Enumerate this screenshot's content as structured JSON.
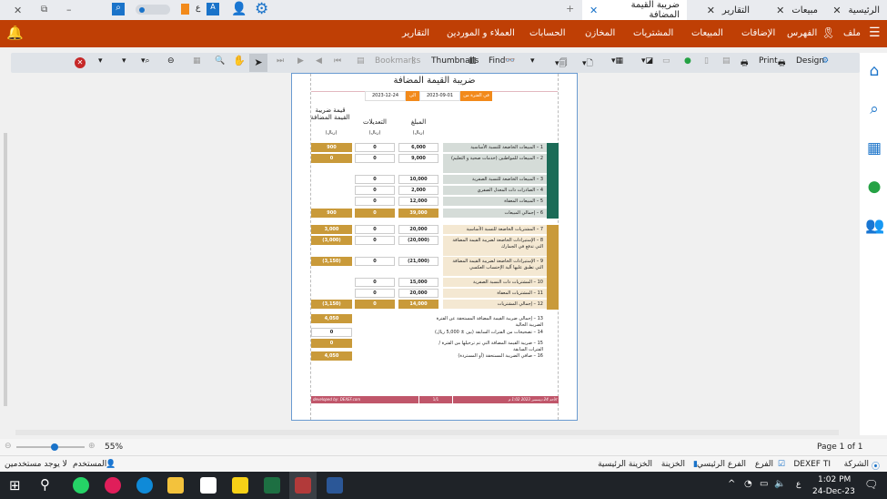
{
  "window": {
    "tabs": [
      {
        "label": "الرئيسية"
      },
      {
        "label": "مبيعات"
      },
      {
        "label": "التقارير"
      },
      {
        "label": "ضريبة القيمة المضافة",
        "active": true
      }
    ],
    "new_tab": "+",
    "lang_indicator": "ع"
  },
  "menu": {
    "items": [
      "ملف",
      "الفهرس",
      "الإضافات",
      "المبيعات",
      "المشتريات",
      "المخازن",
      "الحسابات",
      "العملاء و الموردين",
      "التقارير"
    ]
  },
  "toolbar": {
    "design": "Design",
    "print": "Print",
    "find": "Find",
    "thumbnails": "Thumbnails",
    "bookmarks": "Bookmarks"
  },
  "report": {
    "title": "ضريبة القيمة المضافة",
    "period_from_label": "في الفترة من",
    "date_from": "2023-09-01",
    "to_label": "الى",
    "date_to": "2023-12-24",
    "col_amount": "المبلغ",
    "col_adjust": "التعديلات",
    "col_vat": "قيمة ضريبة القيمة المضافة",
    "unit": "(ريال)",
    "sales_rows": [
      {
        "label": "1 – المبيعات الخاضعة للنسبة الأساسية",
        "amount": "6,000",
        "adj": "0",
        "vat": "900"
      },
      {
        "label": "2 – المبيعات للمواطنين (خدمات صحية و التعليم)",
        "amount": "9,000",
        "adj": "0",
        "vat": "0"
      },
      {
        "label": "3 – المبيعات الخاضعة للنسبة الصفرية",
        "amount": "10,000",
        "adj": "0",
        "vat": ""
      },
      {
        "label": "4 – الصادرات ذات المعدل الصفري",
        "amount": "2,000",
        "adj": "0",
        "vat": ""
      },
      {
        "label": "5 – المبيعات المعفاة",
        "amount": "12,000",
        "adj": "0",
        "vat": ""
      },
      {
        "label": "6 – إجمالي المبيعات",
        "amount": "39,000",
        "adj": "0",
        "vat": "900",
        "total": true
      }
    ],
    "purchase_rows": [
      {
        "label": "7 – المشتريات الخاضعة للنسبة الأساسية",
        "amount": "20,000",
        "adj": "0",
        "vat": "3,000"
      },
      {
        "label": "8 – الإستيرادات الخاضعة لضريبة القيمة المضافة التي تدفع في الجمارك",
        "amount": "(20,000)",
        "adj": "0",
        "vat": "(3,000)"
      },
      {
        "label": "9 – الإستيرادات الخاضعة لضريبة القيمة المضافة التي تطبق عليها آلية الإحتساب العكسي",
        "amount": "(21,000)",
        "adj": "0",
        "vat": "(3,150)"
      },
      {
        "label": "10 – المشتريات ذات النسبة الصفرية",
        "amount": "15,000",
        "adj": "0",
        "vat": ""
      },
      {
        "label": "11 – المشتريات المعفاة",
        "amount": "20,000",
        "adj": "0",
        "vat": ""
      },
      {
        "label": "12 – إجمالي المشتريات",
        "amount": "14,000",
        "adj": "0",
        "vat": "(3,150)",
        "total": true
      }
    ],
    "summary_rows": [
      {
        "label": "13 – إجمالي ضريبة القيمة المضافة المستحقة عن الفترة الضريبة الحالية",
        "vat": "4,050"
      },
      {
        "label": "14 – تصحيحات من الفترات السابقة (بين ± 5,000 ريال)",
        "vat": "0"
      },
      {
        "label": "15 – ضريبة القيمة المضافة التي تم ترحيلها من الفترة / الفترات السابقة",
        "vat": "0"
      },
      {
        "label": "16 – صافي الضريبة المستحقة (أو المستردة)",
        "vat": "4,050"
      }
    ],
    "footer_left": "developed by: DEXEF.com",
    "footer_mid": "1/1",
    "footer_right": "الأحد 24 ديسمبر 2023 1:02 م"
  },
  "zoom": {
    "percent": "55%",
    "level": 0.55
  },
  "page_info": "Page 1 of 1",
  "status": {
    "company_label": "الشركة",
    "company": "DEXEF TI",
    "branch_label": "الفرع",
    "branch": "الفرع الرئيسي",
    "treasury_label": "الخزينة",
    "treasury": "الخزينة الرئيسية",
    "user_label": "المستخدم",
    "users": "لا يوجد مستخدمين"
  },
  "taskbar": {
    "time": "1:02 PM",
    "date": "24-Dec-23",
    "lang": "ع"
  },
  "colors": {
    "menu": "#bf3f05",
    "sales": "#1b6b57",
    "gold": "#c99a3a",
    "footer": "#c0566a"
  }
}
